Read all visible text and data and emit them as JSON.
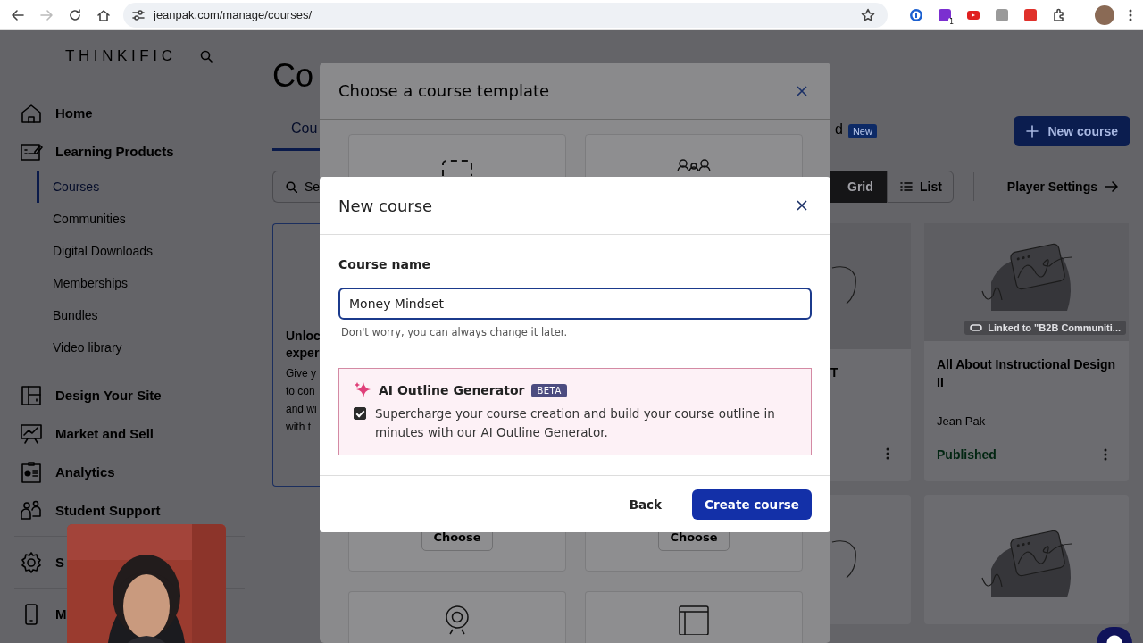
{
  "browser": {
    "url": "jeanpak.com/manage/courses/",
    "extensions": [
      {
        "color": "#1a5fd0"
      },
      {
        "color": "#7b2fd0",
        "badge": "1"
      },
      {
        "color": "#e02020"
      },
      {
        "color": "#9a9a9a"
      },
      {
        "color": "#e0312b"
      }
    ]
  },
  "sidebar": {
    "logo": "THINKIFIC",
    "nav_sections": [
      {
        "items": [
          {
            "label": "Home"
          },
          {
            "label": "Learning Products",
            "children": [
              {
                "label": "Courses",
                "selected": true
              },
              {
                "label": "Communities",
                "selected": false
              },
              {
                "label": "Digital Downloads",
                "selected": false
              },
              {
                "label": "Memberships",
                "selected": false
              },
              {
                "label": "Bundles",
                "selected": false
              },
              {
                "label": "Video library",
                "selected": false
              }
            ]
          },
          {
            "label": "Design Your Site"
          },
          {
            "label": "Market and Sell"
          },
          {
            "label": "Analytics"
          },
          {
            "label": "Student Support"
          }
        ]
      },
      {
        "items": [
          {
            "label": "S"
          }
        ]
      },
      {
        "items": [
          {
            "label": "M"
          }
        ]
      }
    ]
  },
  "page": {
    "title": "Co",
    "tabs": [
      {
        "label": "Cou",
        "selected": true
      },
      {
        "label": "d",
        "selected": false,
        "badge": "New"
      }
    ],
    "new_course_button": "New course",
    "search_placeholder": "Se",
    "views": [
      {
        "label": "Grid",
        "selected": true
      },
      {
        "label": "List",
        "selected": false
      }
    ],
    "player_settings": "Player Settings",
    "promo_card": {
      "title_lines": [
        "Unloc",
        "exper"
      ],
      "text_lines": [
        "Give y",
        "to con",
        "and wi",
        "with t"
      ]
    },
    "courses": [
      {
        "title": "T"
      },
      {
        "title": "All About Instructional Design II",
        "author": "Jean Pak",
        "status": "Published",
        "link": "Linked to \"B2B Communiti..."
      }
    ]
  },
  "template_dialog": {
    "title": "Choose a course template",
    "cards": [
      {
        "button": "Choose"
      },
      {
        "button": "Choose"
      }
    ]
  },
  "new_course_dialog": {
    "title": "New course",
    "field_label": "Course name",
    "field_value": "Money Mindset",
    "hint": "Don't worry, you can always change it later.",
    "ai": {
      "title": "AI Outline Generator",
      "badge": "BETA",
      "checked": true,
      "text": "Supercharge your course creation and build your course outline in minutes with our AI Outline Generator."
    },
    "buttons": [
      {
        "label": "Back",
        "kind": "secondary"
      },
      {
        "label": "Create course",
        "kind": "primary"
      }
    ]
  }
}
